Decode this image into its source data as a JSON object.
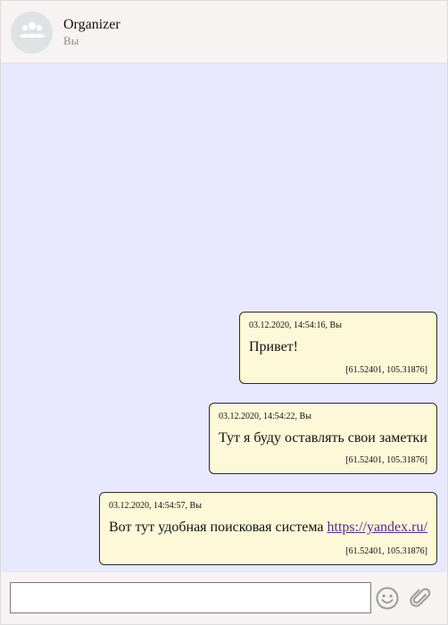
{
  "header": {
    "title": "Organizer",
    "subtitle": "Вы",
    "avatar_icon": "group-icon"
  },
  "messages": [
    {
      "meta": "03.12.2020, 14:54:16, Вы",
      "text": "Привет!",
      "coords": "[61.52401, 105.31876]"
    },
    {
      "meta": "03.12.2020, 14:54:22, Вы",
      "text": "Тут я буду оставлять свои заметки",
      "coords": "[61.52401, 105.31876]"
    },
    {
      "meta": "03.12.2020, 14:54:57, Вы",
      "text": "Вот тут удобная поисковая система ",
      "link": "https://yandex.ru/",
      "coords": "[61.52401, 105.31876]"
    }
  ],
  "composer": {
    "input_value": "",
    "input_placeholder": "",
    "emoji_icon": "smiley-icon",
    "attach_icon": "paperclip-icon"
  },
  "colors": {
    "background": "#e8e8ff",
    "bubble": "#fdf8d8",
    "header": "#f7f3f3",
    "link": "#5b2a86"
  }
}
